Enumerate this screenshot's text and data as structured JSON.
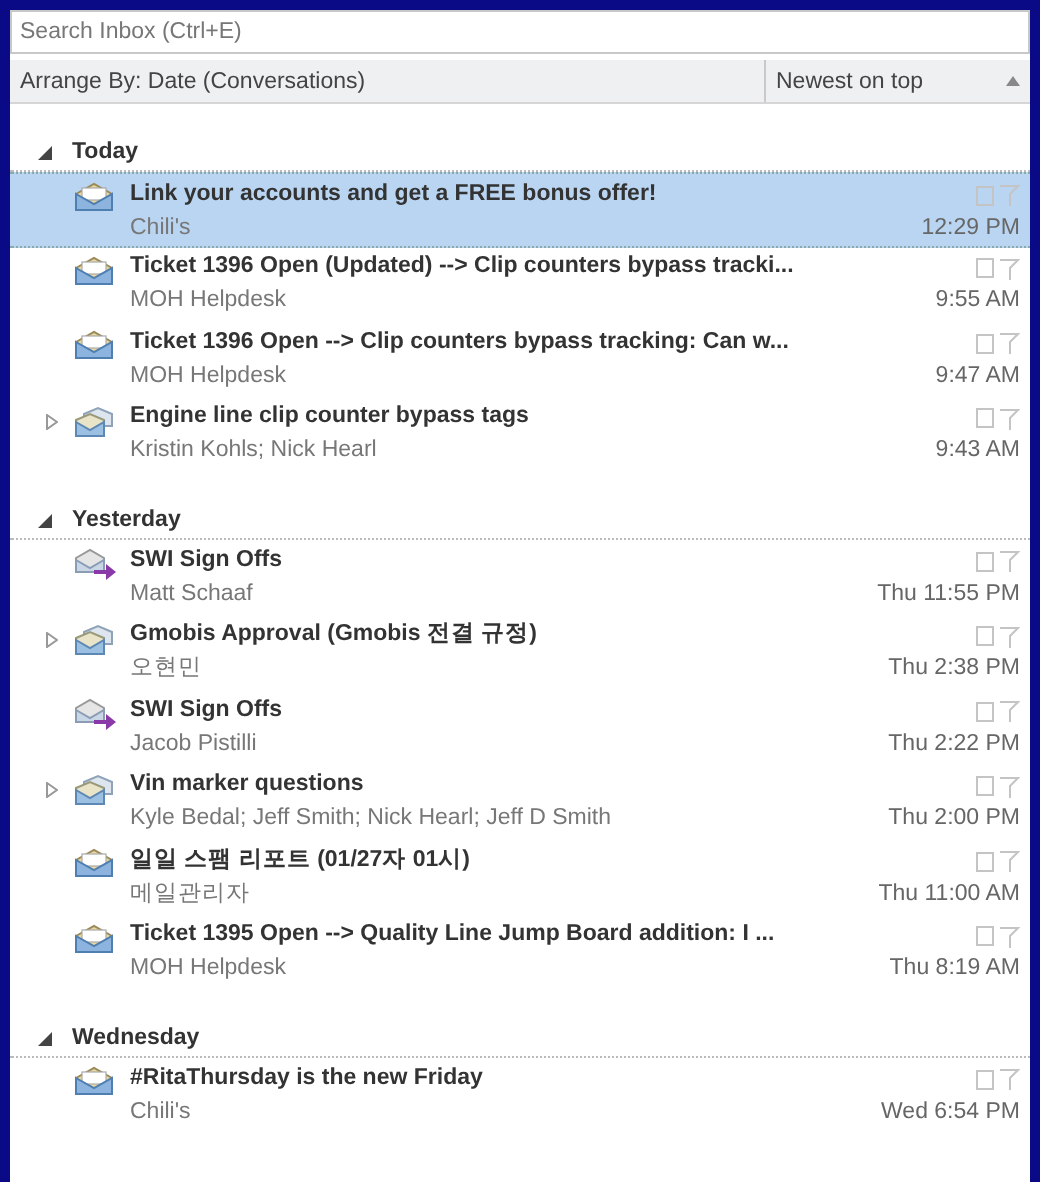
{
  "search": {
    "placeholder": "Search Inbox (Ctrl+E)"
  },
  "arrange": {
    "label": "Arrange By: Date (Conversations)",
    "order": "Newest on top"
  },
  "groups": [
    {
      "title": "Today",
      "expanded": true,
      "messages": [
        {
          "kind": "mail",
          "subject": "Link your accounts and get a FREE bonus offer!",
          "sender": "Chili's",
          "time": "12:29 PM",
          "selected": true
        },
        {
          "kind": "mail",
          "subject": "Ticket 1396 Open (Updated) --> Clip counters bypass tracki...",
          "sender": "MOH Helpdesk",
          "time": "9:55 AM",
          "selected": false
        },
        {
          "kind": "mail",
          "subject": "Ticket 1396 Open --> Clip counters bypass tracking: Can w...",
          "sender": "MOH Helpdesk",
          "time": "9:47 AM",
          "selected": false
        },
        {
          "kind": "conversation",
          "subject": "Engine line clip counter bypass tags",
          "sender": "Kristin Kohls;  Nick Hearl",
          "time": "9:43 AM",
          "selected": false
        }
      ]
    },
    {
      "title": "Yesterday",
      "expanded": true,
      "messages": [
        {
          "kind": "forwarded",
          "subject": "SWI Sign Offs",
          "sender": "Matt Schaaf",
          "time": "Thu 11:55 PM",
          "selected": false
        },
        {
          "kind": "conversation",
          "subject": "Gmobis Approval (Gmobis 전결 규정)",
          "sender": "오현민",
          "time": "Thu 2:38 PM",
          "selected": false
        },
        {
          "kind": "forwarded",
          "subject": "SWI Sign Offs",
          "sender": "Jacob Pistilli",
          "time": "Thu 2:22 PM",
          "selected": false
        },
        {
          "kind": "conversation",
          "subject": "Vin marker questions",
          "sender": "Kyle Bedal;  Jeff Smith;  Nick Hearl;  Jeff D Smith",
          "time": "Thu 2:00 PM",
          "selected": false
        },
        {
          "kind": "mail",
          "subject": "일일 스팸 리포트 (01/27자 01시)",
          "sender": "메일관리자",
          "time": "Thu 11:00 AM",
          "selected": false
        },
        {
          "kind": "mail",
          "subject": "Ticket 1395 Open --> Quality Line Jump Board addition: I ...",
          "sender": "MOH Helpdesk",
          "time": "Thu 8:19 AM",
          "selected": false
        }
      ]
    },
    {
      "title": "Wednesday",
      "expanded": true,
      "messages": [
        {
          "kind": "mail",
          "subject": "#RitaThursday is the new Friday",
          "sender": "Chili's",
          "time": "Wed 6:54 PM",
          "selected": false
        }
      ]
    }
  ]
}
